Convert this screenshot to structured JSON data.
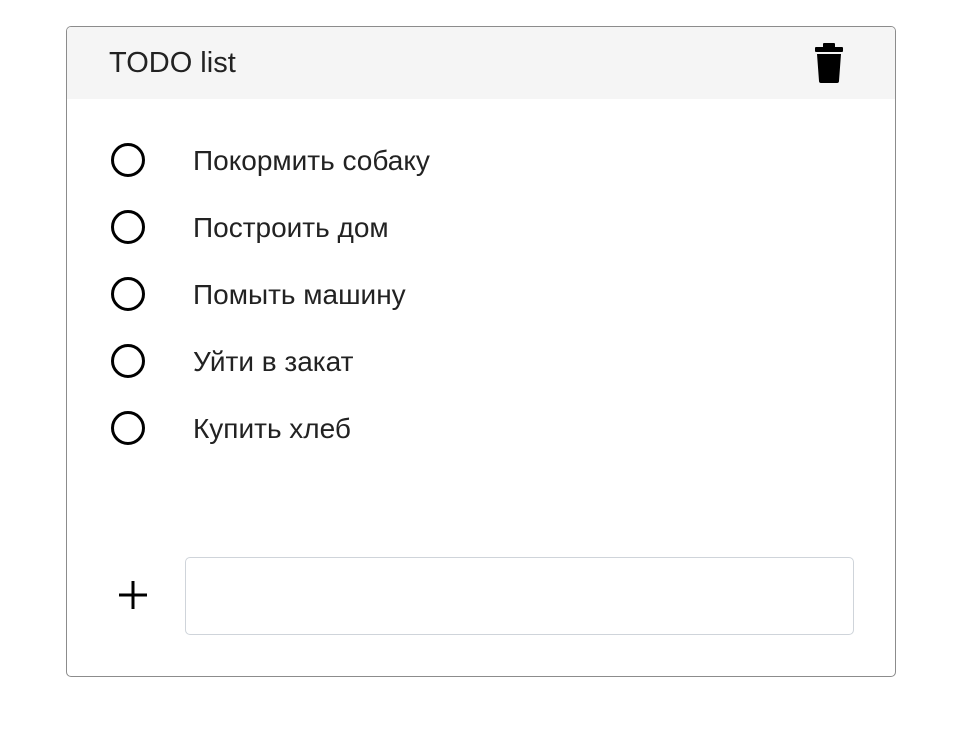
{
  "card": {
    "title": "TODO list",
    "delete_icon": "trash-icon"
  },
  "todos": [
    {
      "label": "Покормить собаку",
      "checked": false
    },
    {
      "label": "Построить дом",
      "checked": false
    },
    {
      "label": "Помыть машину",
      "checked": false
    },
    {
      "label": "Уйти в закат",
      "checked": false
    },
    {
      "label": "Купить хлеб",
      "checked": false
    }
  ],
  "add": {
    "icon": "plus-icon",
    "input_value": "",
    "placeholder": ""
  },
  "colors": {
    "header_bg": "#f5f5f5",
    "border": "#8c8c8c",
    "text": "#222222"
  }
}
